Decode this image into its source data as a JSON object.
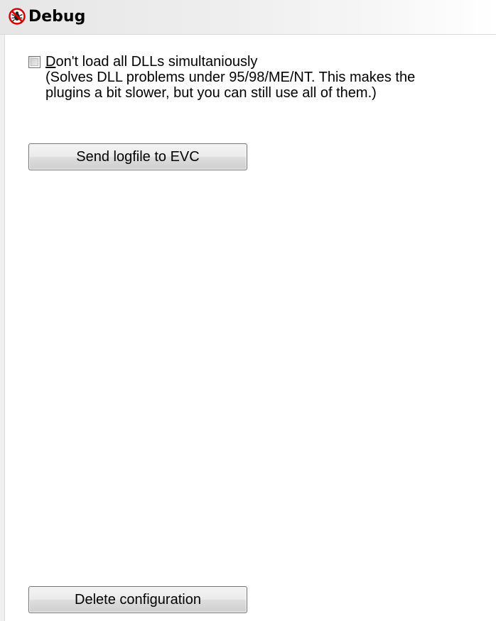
{
  "header": {
    "title": "Debug",
    "icon": "debug-no-bug-icon"
  },
  "option": {
    "checked": false,
    "label_underlined": "D",
    "label_rest": "on't load all DLLs simultaniously",
    "description_line1": "(Solves DLL problems under 95/98/ME/NT. This makes the",
    "description_line2": "plugins a bit slower, but you can still use all of them.)"
  },
  "buttons": {
    "send_logfile": "Send logfile to EVC",
    "delete_configuration": "Delete configuration"
  },
  "colors": {
    "header_gradient_start": "#e6e6e6",
    "header_gradient_end": "#ffffff",
    "icon_red": "#d40000",
    "button_border": "#707070"
  }
}
